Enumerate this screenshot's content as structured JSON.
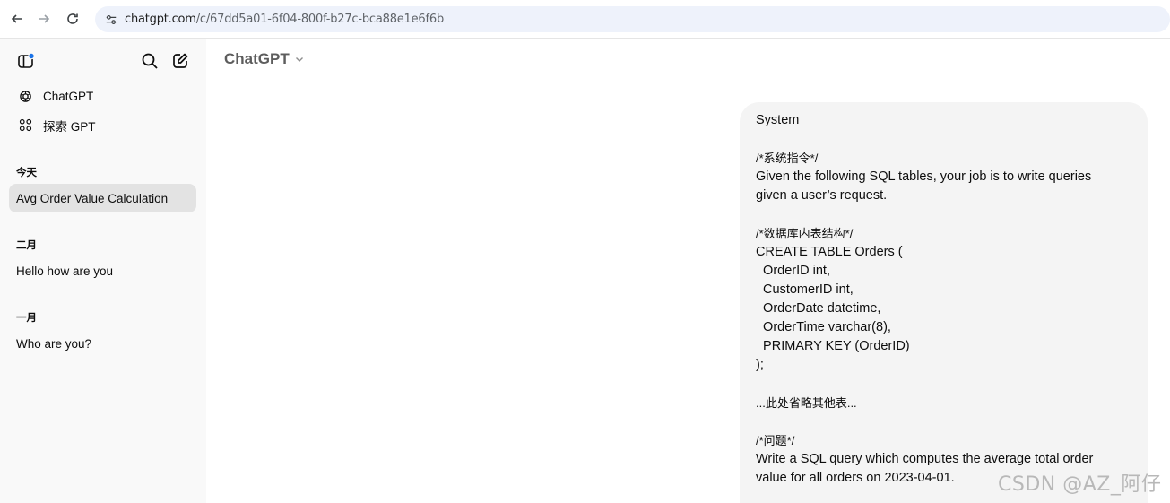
{
  "browser": {
    "url_host": "chatgpt.com",
    "url_path": "/c/67dd5a01-6f04-800f-b27c-bca88e1e6f6b"
  },
  "sidebar": {
    "nav": [
      {
        "label": "ChatGPT",
        "icon": "openai-logo-icon"
      },
      {
        "label": "探索 GPT",
        "icon": "grid-icon"
      }
    ],
    "sections": [
      {
        "title": "今天",
        "chats": [
          "Avg Order Value Calculation"
        ]
      },
      {
        "title": "二月",
        "chats": [
          "Hello how are you"
        ]
      },
      {
        "title": "一月",
        "chats": [
          "Who are you?"
        ]
      }
    ]
  },
  "header": {
    "model_name": "ChatGPT"
  },
  "message": {
    "lines": [
      "System",
      "",
      "/*系统指令*/",
      "Given the following SQL tables, your job is to write queries",
      "given a user’s request.",
      "",
      "/*数据库内表结构*/",
      "CREATE TABLE Orders (",
      "  OrderID int,",
      "  CustomerID int,",
      "  OrderDate datetime,",
      "  OrderTime varchar(8),",
      "  PRIMARY KEY (OrderID)",
      ");",
      "",
      "...此处省略其他表...",
      "",
      "/*问题*/",
      "Write a SQL query which computes the average total order",
      "value for all orders on 2023-04-01."
    ]
  },
  "watermark": "CSDN @AZ_阿仔",
  "colors": {
    "sidebar_bg": "#f9f9f9",
    "active_chat_bg": "#e3e3e3",
    "bubble_bg": "#f4f4f4",
    "url_bar_bg": "#eef2fb",
    "accent_dot": "#1a73e8"
  }
}
